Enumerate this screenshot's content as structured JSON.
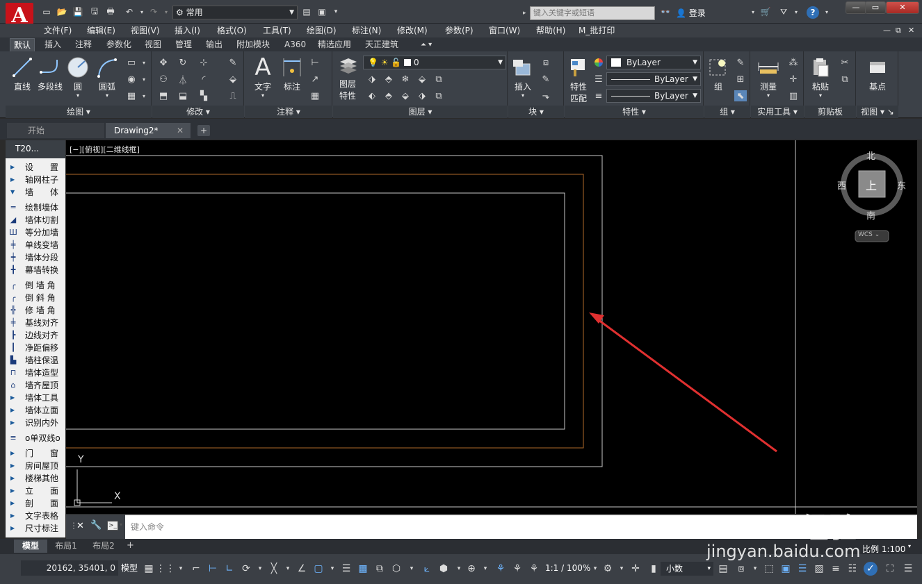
{
  "window": {
    "app_logo": "A",
    "workspace": "常用",
    "search_placeholder": "键入关键字或短语",
    "login": "登录",
    "help": "?"
  },
  "menu": [
    "文件(F)",
    "编辑(E)",
    "视图(V)",
    "插入(I)",
    "格式(O)",
    "工具(T)",
    "绘图(D)",
    "标注(N)",
    "修改(M)",
    "参数(P)",
    "窗口(W)",
    "帮助(H)",
    "M_批打印"
  ],
  "ribbon_tabs": [
    "默认",
    "插入",
    "注释",
    "参数化",
    "视图",
    "管理",
    "输出",
    "附加模块",
    "A360",
    "精选应用",
    "天正建筑"
  ],
  "ribbon": {
    "draw": {
      "line": "直线",
      "polyline": "多段线",
      "circle": "圆",
      "arc": "圆弧",
      "title": "绘图"
    },
    "modify": {
      "title": "修改"
    },
    "annotate": {
      "text": "文字",
      "dimension": "标注",
      "title": "注释"
    },
    "layers": {
      "props": "图层\n特性",
      "props_l1": "图层",
      "props_l2": "特性",
      "current_layer": "0",
      "title": "图层"
    },
    "block": {
      "insert": "插入",
      "title": "块"
    },
    "properties": {
      "match_l1": "特性",
      "match_l2": "匹配",
      "color": "ByLayer",
      "linetype": "ByLayer",
      "lineweight": "ByLayer",
      "title": "特性"
    },
    "groups": {
      "group": "组",
      "title": "组"
    },
    "utilities": {
      "measure": "测量",
      "title": "实用工具"
    },
    "clipboard": {
      "paste": "粘贴",
      "title": "剪贴板"
    },
    "view": {
      "basepoint": "基点",
      "title": "视图"
    }
  },
  "doc_tabs": {
    "start": "开始",
    "drawing": "Drawing2*"
  },
  "palette": {
    "header": "T20...",
    "items": [
      {
        "label": "设　　置",
        "type": "tri"
      },
      {
        "label": "轴网柱子",
        "type": "tri"
      },
      {
        "label": "墙　　体",
        "type": "open"
      },
      {
        "label": "绘制墙体",
        "type": "icon"
      },
      {
        "label": "墙体切割",
        "type": "icon"
      },
      {
        "label": "等分加墙",
        "type": "icon"
      },
      {
        "label": "单线变墙",
        "type": "icon"
      },
      {
        "label": "墙体分段",
        "type": "icon"
      },
      {
        "label": "幕墙转换",
        "type": "icon"
      },
      {
        "label": "倒 墙 角",
        "type": "icon"
      },
      {
        "label": "倒 斜 角",
        "type": "icon"
      },
      {
        "label": "修 墙 角",
        "type": "icon"
      },
      {
        "label": "基线对齐",
        "type": "icon"
      },
      {
        "label": "边线对齐",
        "type": "icon"
      },
      {
        "label": "净距偏移",
        "type": "icon"
      },
      {
        "label": "墙柱保温",
        "type": "icon"
      },
      {
        "label": "墙体造型",
        "type": "icon"
      },
      {
        "label": "墙齐屋顶",
        "type": "icon"
      },
      {
        "label": "墙体工具",
        "type": "tri"
      },
      {
        "label": "墙体立面",
        "type": "tri"
      },
      {
        "label": "识别内外",
        "type": "tri"
      },
      {
        "label": "o单双线o",
        "type": "icon"
      },
      {
        "label": "门　　窗",
        "type": "tri"
      },
      {
        "label": "房间屋顶",
        "type": "tri"
      },
      {
        "label": "楼梯其他",
        "type": "tri"
      },
      {
        "label": "立　　面",
        "type": "tri"
      },
      {
        "label": "剖　　面",
        "type": "tri"
      },
      {
        "label": "文字表格",
        "type": "tri"
      },
      {
        "label": "尺寸标注",
        "type": "tri"
      }
    ]
  },
  "viewport": {
    "label": "[−][俯视][二维线框]",
    "compass": {
      "north": "北",
      "south": "南",
      "east": "东",
      "west": "西",
      "top": "上"
    },
    "wcs": "WCS ⌄",
    "ucs_x": "X",
    "ucs_y": "Y"
  },
  "command": {
    "placeholder": "键入命令"
  },
  "layout_tabs": [
    "模型",
    "布局1",
    "布局2"
  ],
  "status": {
    "coords": "20162, 35401, 0",
    "model": "模型",
    "scale": "1:1 / 100%",
    "units": "小数",
    "annotation_scale": "比例 1:100"
  },
  "watermark": {
    "brand": "Baidu经验",
    "url": "jingyan.baidu.com"
  },
  "colors": {
    "accent_red": "#e03030",
    "logo_red": "#c8121a",
    "canvas": "#000000",
    "orange_line": "#b06a2a"
  }
}
